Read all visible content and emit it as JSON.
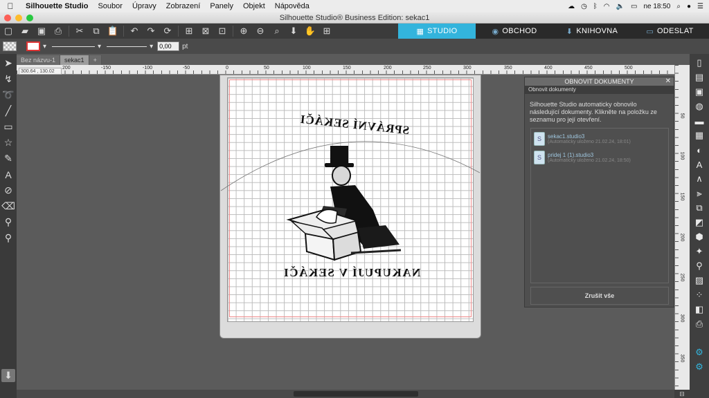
{
  "menubar": {
    "app": "Silhouette Studio",
    "items": [
      "Soubor",
      "Úpravy",
      "Zobrazení",
      "Panely",
      "Objekt",
      "Nápověda"
    ],
    "clock": "ne 18:50"
  },
  "window": {
    "title": "Silhouette Studio® Business Edition: sekac1"
  },
  "nav": {
    "studio": "STUDIO",
    "store": "OBCHOD",
    "library": "KNIHOVNA",
    "send": "ODESLAT"
  },
  "options": {
    "line_width": "0,00",
    "unit": "pt"
  },
  "doc_tabs": [
    "Bez názvu-1",
    "sekac1"
  ],
  "coords": "300.64 , 130.02",
  "ruler_h": [
    "200",
    "-150",
    "-100",
    "-50",
    "0",
    "50",
    "100",
    "150",
    "200",
    "250",
    "300",
    "350",
    "400",
    "450",
    "500"
  ],
  "ruler_v": [
    "50",
    "100",
    "150",
    "200",
    "250",
    "300",
    "350"
  ],
  "design": {
    "top_text": "SPRÁVNÍ SEKÁČI",
    "bottom_text": "NAKUPUJÍ V SEKÁČI"
  },
  "recover_panel": {
    "title": "OBNOVIT DOKUMENTY",
    "subtitle": "Obnovit dokumenty",
    "description": "Silhouette Studio automaticky obnovilo následující dokumenty. Klikněte na položku ze seznamu pro její otevření.",
    "items": [
      {
        "name": "sekac1.studio3",
        "meta": "(Automaticky uloženo 21.02.24, 18:01)"
      },
      {
        "name": "pridej 1 (1).studio3",
        "meta": "(Automaticky uloženo 21.02.24, 18:50)"
      }
    ],
    "cancel_all": "Zrušit vše"
  },
  "colors": {
    "studio_tab": "#33b4dc",
    "nav_dark": "#2a8fb5"
  }
}
